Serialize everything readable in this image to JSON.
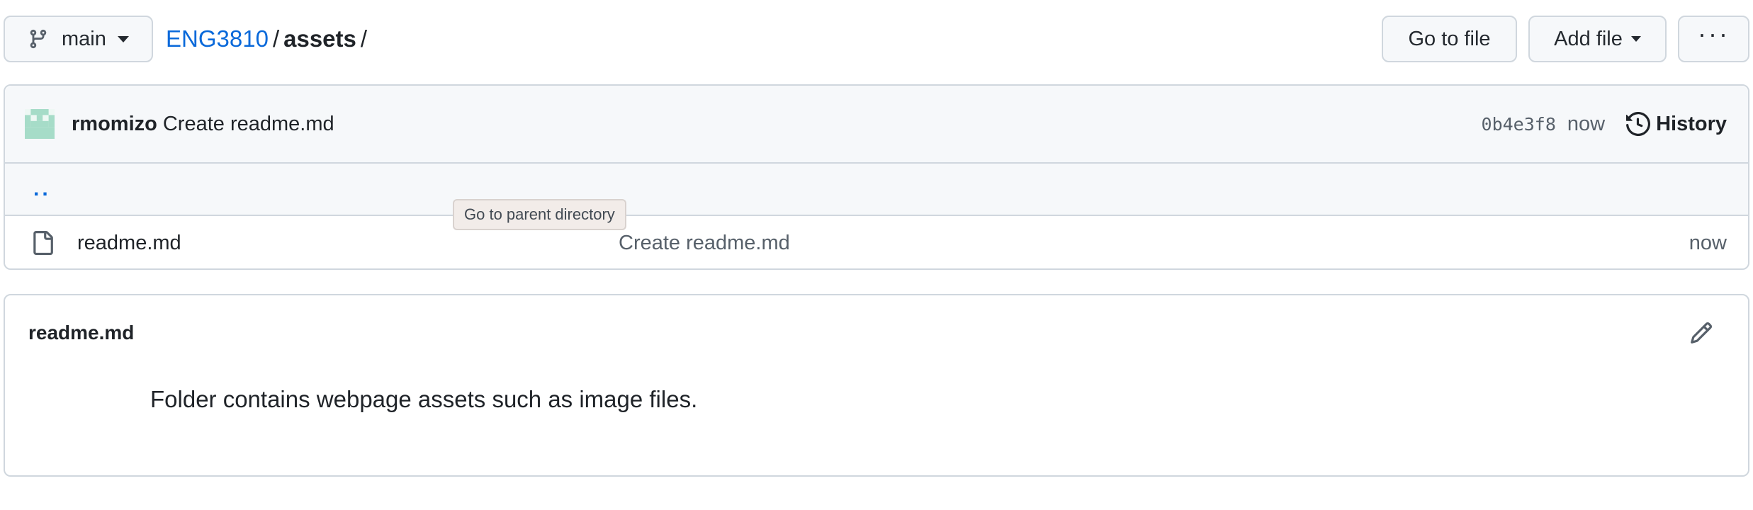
{
  "branch": {
    "name": "main"
  },
  "breadcrumb": {
    "repo": "ENG3810",
    "sep1": "/",
    "folder": "assets",
    "sep2": "/"
  },
  "toolbar": {
    "go_to_file": "Go to file",
    "add_file": "Add file",
    "more": "···"
  },
  "commit": {
    "author": "rmomizo",
    "message": "Create readme.md",
    "sha": "0b4e3f8",
    "time": "now",
    "history_label": "History"
  },
  "parent_dir": {
    "label": "..",
    "tooltip": "Go to parent directory"
  },
  "files": [
    {
      "name": "readme.md",
      "commit_message": "Create readme.md",
      "time": "now"
    }
  ],
  "readme": {
    "title": "readme.md",
    "content": "Folder contains webpage assets such as image files."
  },
  "colors": {
    "link": "#0969da",
    "border": "#d0d7de",
    "muted": "#57606a",
    "avatar": "#a6dcc8"
  },
  "icons": [
    "git-branch-icon",
    "caret-down-icon",
    "history-icon",
    "file-icon",
    "pencil-icon",
    "avatar-identicon"
  ]
}
